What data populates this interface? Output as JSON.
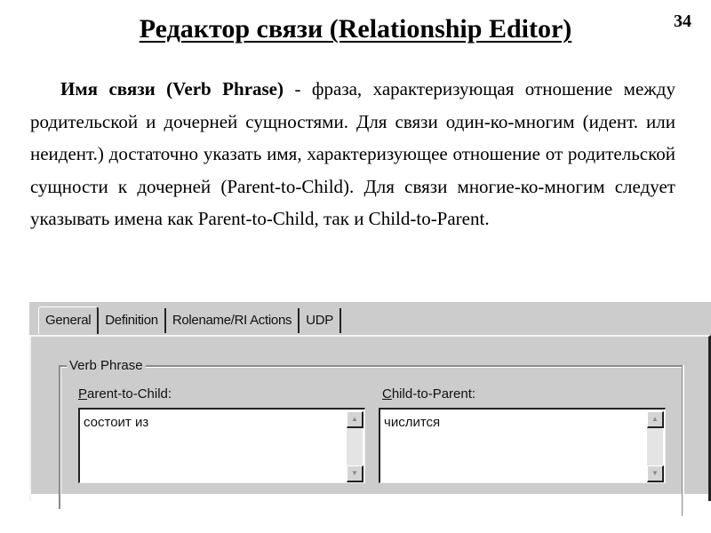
{
  "slide": {
    "title": "Редактор связи (Relationship Editor)",
    "page_number": "34",
    "paragraph_bold": "Имя связи (Verb Phrase)",
    "paragraph_rest": " - фраза, характеризующая отношение между родительской и дочерней сущностями. Для связи один-ко-многим (идент. или неидент.) достаточно указать имя, характеризующее отношение от родительской сущности к дочерней (Parent-to-Child). Для связи многие-ко-многим следует указывать имена как Parent-to-Child, так и Child-to-Parent."
  },
  "dialog": {
    "tabs": [
      {
        "label": "General",
        "active": true
      },
      {
        "label": "Definition",
        "active": false
      },
      {
        "label": "Rolename/RI Actions",
        "active": false
      },
      {
        "label": "UDP",
        "active": false
      }
    ],
    "group_label": "Verb Phrase",
    "parent_to_child": {
      "label_accel": "P",
      "label_rest": "arent-to-Child:",
      "value": "состоит из"
    },
    "child_to_parent": {
      "label_accel": "C",
      "label_rest": "hild-to-Parent:",
      "value": "числится"
    },
    "icons": {
      "scroll_up": "▲",
      "scroll_down": "▼"
    }
  }
}
